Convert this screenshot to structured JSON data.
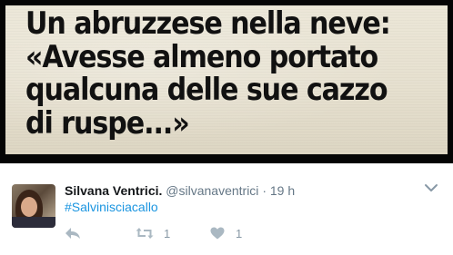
{
  "media": {
    "headline": "Un abruzzese nella neve:\n«Avesse almeno portato\nqualcuna delle sue cazzo\ndi ruspe...»"
  },
  "tweet": {
    "author_name": "Silvana Ventrici.",
    "handle": "@silvanaventrici",
    "separator": "·",
    "time": "19 h",
    "hashtag": "#Salvinisciacallo"
  },
  "actions": {
    "reply_icon": "reply-icon",
    "retweet_icon": "retweet-icon",
    "retweet_count": "1",
    "like_icon": "heart-icon",
    "like_count": "1",
    "more_icon": "chevron-down-icon"
  },
  "colors": {
    "link": "#1b95e0",
    "secondary_text": "#657786",
    "action_icon": "#aab8c2"
  }
}
